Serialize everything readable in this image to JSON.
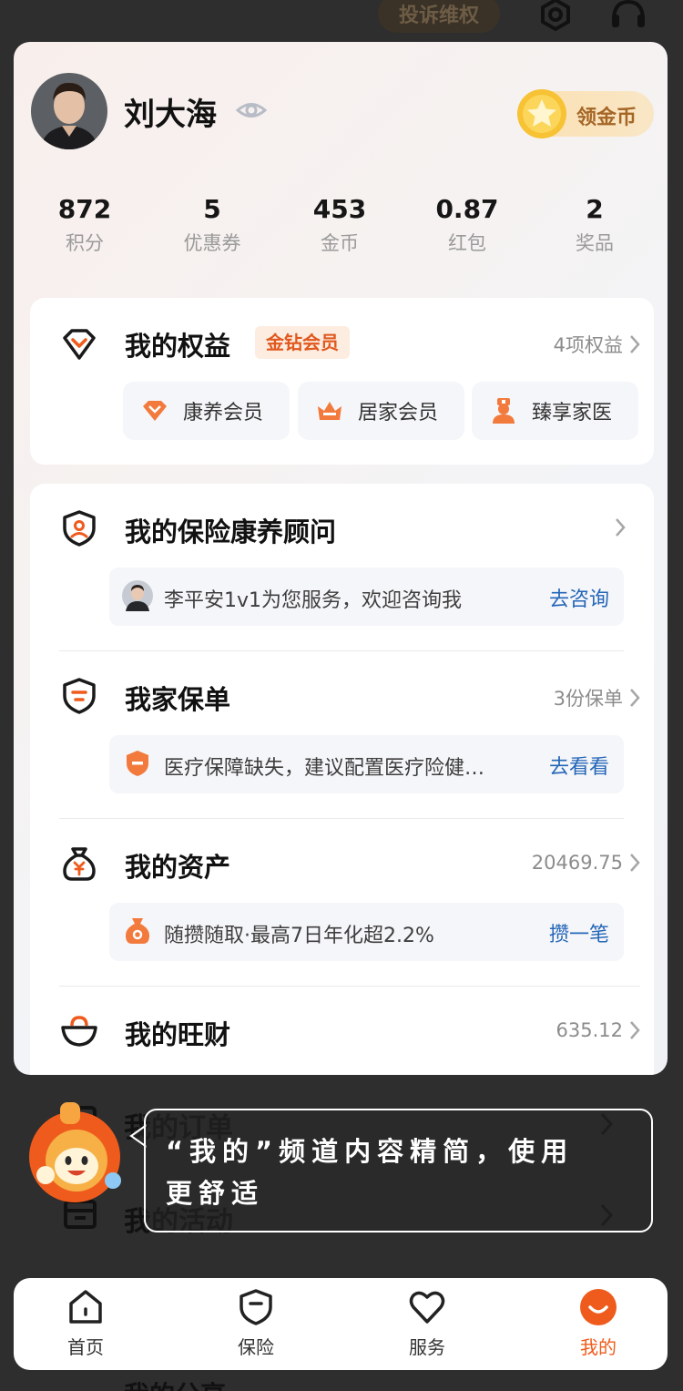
{
  "header": {
    "complaint_label": "投诉维权"
  },
  "profile": {
    "name": "刘大海",
    "coin_button_label": "领金币"
  },
  "stats": [
    {
      "value": "872",
      "label": "积分"
    },
    {
      "value": "5",
      "label": "优惠券"
    },
    {
      "value": "453",
      "label": "金币"
    },
    {
      "value": "0.87",
      "label": "红包"
    },
    {
      "value": "2",
      "label": "奖品"
    }
  ],
  "rights": {
    "title": "我的权益",
    "badge": "金钻会员",
    "count_link": "4项权益",
    "benefits": [
      {
        "label": "康养会员"
      },
      {
        "label": "居家会员"
      },
      {
        "label": "臻享家医"
      }
    ]
  },
  "advisor": {
    "title": "我的保险康养顾问",
    "message": "李平安1v1为您服务，欢迎咨询我",
    "action": "去咨询"
  },
  "policy": {
    "title": "我家保单",
    "count_link": "3份保单",
    "message": "医疗保障缺失，建议配置医疗险健…",
    "action": "去看看"
  },
  "assets": {
    "title": "我的资产",
    "amount": "20469.75",
    "message": "随攒随取·最高7日年化超2.2%",
    "action": "攒一笔"
  },
  "wangcai": {
    "title": "我的旺财",
    "amount": "635.12"
  },
  "dimmed": {
    "orders_label": "我的订单",
    "activity_label": "我的活动",
    "share_label": "我的分享"
  },
  "tooltip": {
    "line1": "“我的”频道内容精简，使用",
    "line2": "更舒适"
  },
  "tabs": [
    {
      "label": "首页",
      "active": false
    },
    {
      "label": "保险",
      "active": false
    },
    {
      "label": "服务",
      "active": false
    },
    {
      "label": "我的",
      "active": true
    }
  ],
  "colors": {
    "accent": "#ef5b1c",
    "link_blue": "#2466b8",
    "gold": "#f6b91b"
  }
}
